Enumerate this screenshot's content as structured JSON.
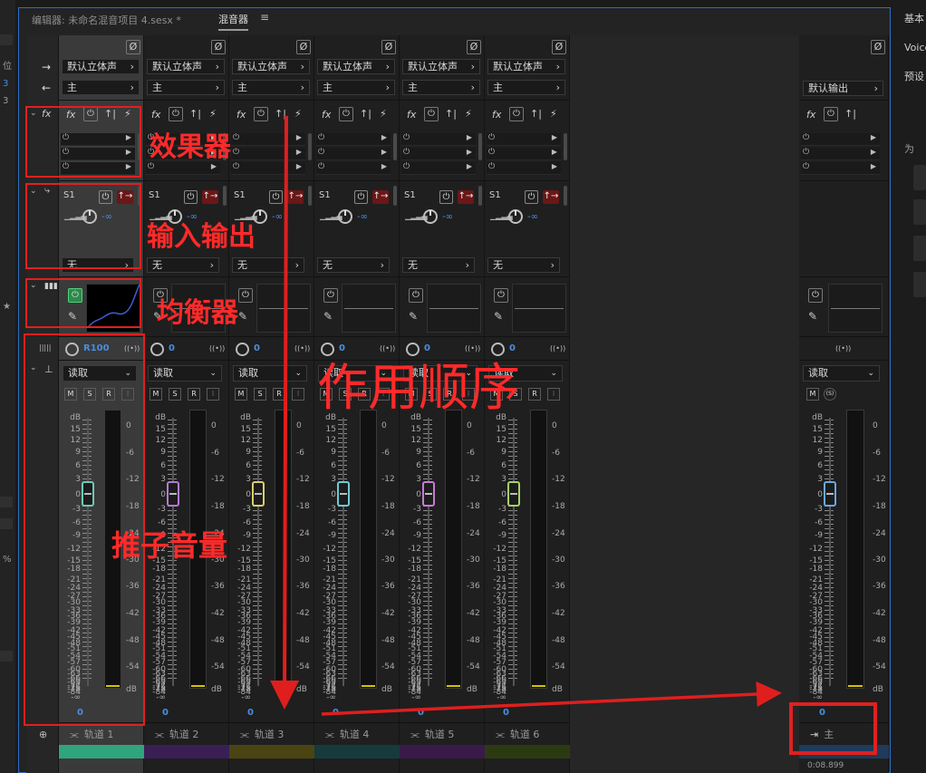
{
  "tabs": {
    "editor": "编辑器: 未命名混音项目 4.sesx *",
    "mixer": "混音器",
    "menu_icon": "≡"
  },
  "left_strip": {
    "label_pos": "位",
    "label_3a": "3",
    "label_3b": "3",
    "label_pct": "%"
  },
  "right_panel": {
    "tab_basic": "基本",
    "voice": "Voice",
    "preset": "预设",
    "for": "为"
  },
  "tracks": [
    {
      "name": "轨道 1",
      "input": "默认立体声",
      "output": "主",
      "send": "S1",
      "send_vol": "-∞",
      "send_dest": "无",
      "pan": "R100",
      "mode": "读取",
      "fader": "0",
      "color": "#2fa57d",
      "fader_color": "#6dc9b6",
      "eq_on": true
    },
    {
      "name": "轨道 2",
      "input": "默认立体声",
      "output": "主",
      "send": "S1",
      "send_vol": "-∞",
      "send_dest": "无",
      "pan": "0",
      "mode": "读取",
      "fader": "0",
      "color": "#3a1f55",
      "fader_color": "#b57ad0",
      "eq_on": false
    },
    {
      "name": "轨道 3",
      "input": "默认立体声",
      "output": "主",
      "send": "S1",
      "send_vol": "-∞",
      "send_dest": "无",
      "pan": "0",
      "mode": "读取",
      "fader": "0",
      "color": "#4a4412",
      "fader_color": "#d8cf6a",
      "eq_on": false
    },
    {
      "name": "轨道 4",
      "input": "默认立体声",
      "output": "主",
      "send": "S1",
      "send_vol": "-∞",
      "send_dest": "无",
      "pan": "0",
      "mode": "读取",
      "fader": "0",
      "color": "#173a3c",
      "fader_color": "#6dcbd3",
      "eq_on": false
    },
    {
      "name": "轨道 5",
      "input": "默认立体声",
      "output": "主",
      "send": "S1",
      "send_vol": "-∞",
      "send_dest": "无",
      "pan": "0",
      "mode": "读取",
      "fader": "0",
      "color": "#3a1a4a",
      "fader_color": "#c97ad6",
      "eq_on": false
    },
    {
      "name": "轨道 6",
      "input": "默认立体声",
      "output": "主",
      "send": "S1",
      "send_vol": "-∞",
      "send_dest": "无",
      "pan": "0",
      "mode": "读取",
      "fader": "0",
      "color": "#2c3a12",
      "fader_color": "#a6d06a",
      "eq_on": false
    }
  ],
  "master": {
    "name": "主",
    "output": "默认输出",
    "mode": "读取",
    "fader": "0",
    "fader_color": "#6aa8e0"
  },
  "db_scale_left": [
    "dB",
    "15",
    "12",
    "9",
    "6",
    "3",
    "0",
    "-3",
    "-6",
    "-9",
    "-12",
    "-15",
    "-18",
    "-21",
    "-24",
    "-27",
    "-30",
    "-33",
    "-36",
    "-39",
    "-42",
    "-45",
    "-48",
    "-51",
    "-54",
    "-57",
    "-60",
    "-63",
    "-66",
    "-69",
    "-72",
    "-75",
    "-78",
    "-84",
    "-∞"
  ],
  "db_scale_right": [
    "0",
    "-6",
    "-12",
    "-18",
    "-24",
    "-30",
    "-36",
    "-42",
    "-48",
    "-54",
    "dB"
  ],
  "msr_labels": {
    "m": "M",
    "s": "S",
    "r": "R",
    "i": "I"
  },
  "icons": {
    "phase": "Ø",
    "fx": "fx",
    "power": "⏻",
    "pencil": "✎",
    "stereo": "((•))"
  },
  "annotations": {
    "effects": "效果器",
    "io": "输入输出",
    "eq": "均衡器",
    "fader": "推子音量",
    "order": "作用顺序"
  },
  "timecode": "0:08.899"
}
